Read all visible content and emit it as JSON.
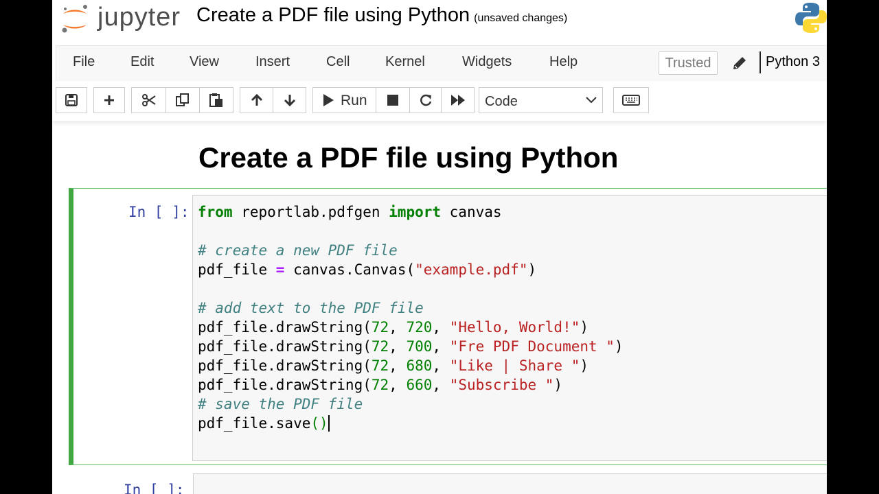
{
  "header": {
    "logo_text": "jupyter",
    "notebook_name": "Create a PDF file using Python",
    "save_status": "(unsaved changes)"
  },
  "menubar": {
    "items": [
      "File",
      "Edit",
      "View",
      "Insert",
      "Cell",
      "Kernel",
      "Widgets",
      "Help"
    ],
    "trusted_label": "Trusted",
    "kernel_name": "Python 3"
  },
  "toolbar": {
    "run_label": "Run",
    "cell_type": "Code",
    "buttons": [
      "save-icon",
      "plus-icon",
      "scissors-icon",
      "copy-icon",
      "paste-icon",
      "arrow-up-icon",
      "arrow-down-icon",
      "play-icon",
      "stop-icon",
      "restart-icon",
      "fast-forward-icon",
      "keyboard-icon"
    ]
  },
  "notebook": {
    "heading": "Create a PDF file using Python",
    "cells": [
      {
        "prompt": "In [ ]:",
        "code": [
          "from reportlab.pdfgen import canvas",
          "",
          "# create a new PDF file",
          "pdf_file = canvas.Canvas(\"example.pdf\")",
          "",
          "# add text to the PDF file",
          "pdf_file.drawString(72, 720, \"Hello, World!\")",
          "pdf_file.drawString(72, 700, \"Fre PDF Document \")",
          "pdf_file.drawString(72, 680, \"Like | Share \")",
          "pdf_file.drawString(72, 660, \"Subscribe \")",
          "# save the PDF file",
          "pdf_file.save()"
        ]
      },
      {
        "prompt": "In [ ]:",
        "code": []
      }
    ]
  },
  "colors": {
    "selected_cell_border": "#42a642",
    "prompt": "#303f9f",
    "keyword": "#008000",
    "string": "#ba2121",
    "comment": "#408080"
  }
}
